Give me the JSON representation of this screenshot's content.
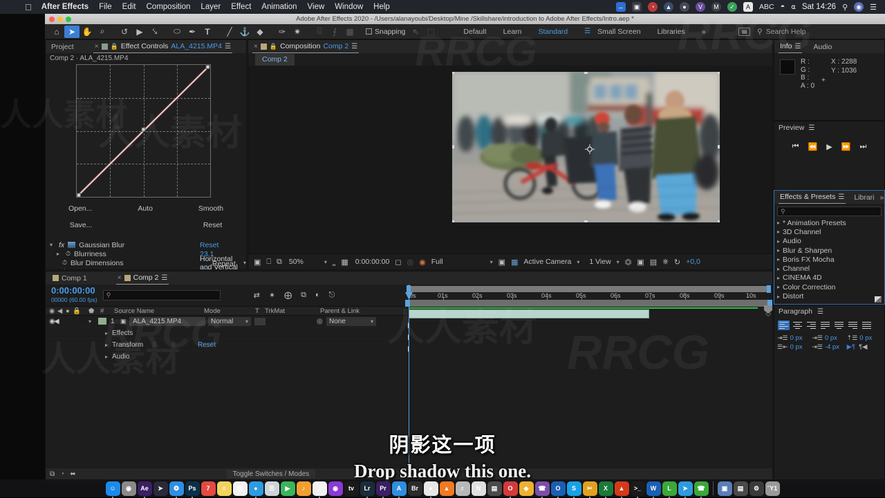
{
  "macos": {
    "apple_glyph": "&#63743;",
    "menus": [
      "After Effects",
      "File",
      "Edit",
      "Composition",
      "Layer",
      "Effect",
      "Animation",
      "View",
      "Window",
      "Help"
    ],
    "tray": [
      {
        "name": "displays-icon",
        "glyph": "↔",
        "color": "#2b6fd4"
      },
      {
        "name": "screen-record-icon",
        "glyph": "▣",
        "color": "#3a3f48"
      },
      {
        "name": "clock-alert-icon",
        "glyph": "◔",
        "color": "#b93a3a"
      },
      {
        "name": "bell-icon",
        "glyph": "▲",
        "color": "#3a4b6b"
      },
      {
        "name": "ninja-icon",
        "glyph": "●",
        "color": "#454a52"
      },
      {
        "name": "app-v-icon",
        "glyph": "V",
        "color": "#6a4b9c"
      },
      {
        "name": "app-m-icon",
        "glyph": "M",
        "color": "#3a3f48"
      },
      {
        "name": "checkmark-icon",
        "glyph": "✓",
        "color": "#3aa05a"
      },
      {
        "name": "letter-a-icon",
        "glyph": "A",
        "color": "#e8e8e8"
      }
    ],
    "abc_label": "ABC",
    "wifi_icon": "wifi-icon",
    "battery_icon": "battery-charging-icon",
    "clock": "Sat 14:26",
    "spotlight_icon": "search-icon",
    "siri_icon": "siri-icon",
    "control_center_icon": "control-center-icon"
  },
  "window": {
    "title": "Adobe After Effects 2020 - /Users/alanayoubi/Desktop/Mine /Skillshare/introduction to Adobe After Effects/Intro.aep *"
  },
  "toolbar": {
    "tools": [
      {
        "name": "home-icon",
        "glyph": "⌂",
        "selected": false
      },
      {
        "name": "selection-tool-icon",
        "glyph": "➤",
        "selected": true
      },
      {
        "name": "hand-tool-icon",
        "glyph": "✋",
        "selected": false
      },
      {
        "name": "zoom-tool-icon",
        "glyph": "⌕",
        "selected": false
      },
      {
        "name": "rotation-tool-icon",
        "glyph": "↺",
        "selected": false
      },
      {
        "name": "camera-tool-icon",
        "glyph": "▶",
        "selected": false
      },
      {
        "name": "anchor-point-tool-icon",
        "glyph": "✥",
        "selected": false
      },
      {
        "name": "shape-tool-icon",
        "glyph": "⬭",
        "selected": false
      },
      {
        "name": "pen-tool-icon",
        "glyph": "✒",
        "selected": false
      },
      {
        "name": "type-tool-icon",
        "glyph": "T",
        "selected": false
      },
      {
        "name": "brush-tool-icon",
        "glyph": "╱",
        "selected": false
      },
      {
        "name": "clone-stamp-tool-icon",
        "glyph": "⚓",
        "selected": false
      },
      {
        "name": "eraser-tool-icon",
        "glyph": "◆",
        "selected": false
      },
      {
        "name": "roto-brush-tool-icon",
        "glyph": "✒",
        "selected": false
      },
      {
        "name": "puppet-pin-tool-icon",
        "glyph": "✷",
        "selected": false
      }
    ],
    "dim_tools": [
      {
        "name": "align-left-icon",
        "glyph": "⌸"
      },
      {
        "name": "align-center-icon",
        "glyph": "⨍"
      },
      {
        "name": "distribute-icon",
        "glyph": "▦"
      }
    ],
    "snapping_label": "Snapping",
    "snap_extra": [
      {
        "name": "snap-arrow-icon",
        "glyph": "↖"
      },
      {
        "name": "snap-target-icon",
        "glyph": "⬚"
      }
    ],
    "workspaces": [
      "Default",
      "Learn",
      "Standard",
      "Small Screen",
      "Libraries"
    ],
    "active_workspace": "Standard",
    "overflow_label": "»",
    "workspace_menu_icon": "hamburger-icon",
    "sync_settings_icon": "sync-settings-icon",
    "search_help_placeholder": "Search Help",
    "search_help_icon": "search-icon"
  },
  "effect_controls": {
    "tabs": [
      {
        "name": "project-tab",
        "label": "Project",
        "active": false,
        "closeable": false
      },
      {
        "name": "effect-controls-tab",
        "label": "Effect Controls",
        "value": "ALA_4215.MP4",
        "active": true,
        "closeable": true
      }
    ],
    "panel_menu_icon": "hamburger-icon",
    "subtitle": "Comp 2 · ALA_4215.MP4",
    "curves": {
      "name": "curves-graph",
      "grid_lines": 4,
      "channels": [
        "composite",
        "red",
        "green"
      ]
    },
    "buttons_row1": [
      {
        "name": "open-button",
        "label": "Open..."
      },
      {
        "name": "auto-button",
        "label": "Auto"
      },
      {
        "name": "smooth-button",
        "label": "Smooth"
      }
    ],
    "buttons_row2": [
      {
        "name": "save-button",
        "label": "Save..."
      },
      {
        "name": "curves-reset-button",
        "label": "Reset"
      }
    ],
    "gaussian_blur": {
      "fx_label": "fx",
      "title": "Gaussian Blur",
      "reset_label": "Reset",
      "properties": [
        {
          "name": "blurriness-property",
          "label": "Blurriness",
          "value": "23,1",
          "type": "number",
          "expandable": true
        },
        {
          "name": "blur-dimensions-property",
          "label": "Blur Dimensions",
          "value": "Horizontal and Vertical",
          "type": "dropdown",
          "expandable": false
        },
        {
          "name": "repeat-edge-pixels-property",
          "label": "Repeat Edge Pixels",
          "value": "",
          "type": "checkbox",
          "checked": true
        }
      ]
    }
  },
  "composition": {
    "tab": {
      "label": "Composition",
      "value": "Comp 2",
      "closeable": true
    },
    "panel_menu_icon": "hamburger-icon",
    "comp_tab": "Comp 2",
    "viewer_bar": {
      "magnification": "50%",
      "time": "0:00:00:00",
      "resolution": "Full",
      "camera": "Active Camera",
      "views": "1 View",
      "offset": "+0,0",
      "icons": [
        {
          "name": "always-preview-icon",
          "glyph": "▣"
        },
        {
          "name": "toggle-transparency-icon",
          "glyph": "⌸"
        },
        {
          "name": "toggle-mask-icon",
          "glyph": "⧉"
        },
        {
          "name": "snapshot-icon",
          "glyph": "὏7"
        },
        {
          "name": "show-snapshot-icon",
          "glyph": "◎"
        },
        {
          "name": "channel-icon",
          "glyph": "◕"
        },
        {
          "name": "region-of-interest-icon",
          "glyph": "▢"
        },
        {
          "name": "transparency-grid-icon",
          "glyph": "▒"
        },
        {
          "name": "pixel-aspect-icon",
          "glyph": "⊞"
        },
        {
          "name": "fast-previews-icon",
          "glyph": "⚡"
        },
        {
          "name": "timeline-icon",
          "glyph": "☷"
        },
        {
          "name": "comp-flowchart-icon",
          "glyph": "⑂"
        },
        {
          "name": "reset-exposure-icon",
          "glyph": "↻"
        }
      ]
    }
  },
  "info_panel": {
    "tabs": [
      "Info",
      "Audio"
    ],
    "panel_menu_icon": "hamburger-icon",
    "channels": [
      {
        "label": "R :",
        "value": ""
      },
      {
        "label": "G :",
        "value": ""
      },
      {
        "label": "B :",
        "value": ""
      },
      {
        "label": "A :",
        "value": "0"
      }
    ],
    "coords": [
      {
        "label": "X :",
        "value": "2288"
      },
      {
        "label": "Y :",
        "value": "1036"
      }
    ]
  },
  "preview_panel": {
    "title": "Preview",
    "panel_menu_icon": "hamburger-icon",
    "controls": [
      {
        "name": "first-frame-button",
        "glyph": "⧏|"
      },
      {
        "name": "previous-frame-button",
        "glyph": "◀|"
      },
      {
        "name": "play-button",
        "glyph": "▶"
      },
      {
        "name": "next-frame-button",
        "glyph": "|▶"
      },
      {
        "name": "last-frame-button",
        "glyph": "|▷"
      }
    ]
  },
  "effects_presets": {
    "tabs": [
      "Effects & Presets",
      "Librari"
    ],
    "panel_menu_icon": "hamburger-icon",
    "overflow": "»",
    "search_placeholder": "",
    "search_icon": "search-icon",
    "items": [
      "* Animation Presets",
      "3D Channel",
      "Audio",
      "Blur & Sharpen",
      "Boris FX Mocha",
      "Channel",
      "CINEMA 4D",
      "Color Correction",
      "Distort"
    ]
  },
  "paragraph_panel": {
    "title": "Paragraph",
    "panel_menu_icon": "hamburger-icon",
    "align_buttons": [
      {
        "name": "align-left-button",
        "selected": true
      },
      {
        "name": "align-center-button",
        "selected": false
      },
      {
        "name": "align-right-button",
        "selected": false
      },
      {
        "name": "justify-last-left-button",
        "selected": false
      },
      {
        "name": "justify-last-center-button",
        "selected": false
      },
      {
        "name": "justify-last-right-button",
        "selected": false
      },
      {
        "name": "justify-all-button",
        "selected": false
      }
    ],
    "indents": [
      {
        "name": "indent-left-margin",
        "icon": "indent-left-icon",
        "value": "0 px"
      },
      {
        "name": "indent-first-line",
        "icon": "first-line-indent-icon",
        "value": "0 px"
      },
      {
        "name": "space-before-paragraph",
        "icon": "space-before-icon",
        "value": "0 px"
      },
      {
        "name": "indent-right-margin",
        "icon": "indent-right-icon",
        "value": "0 px"
      },
      {
        "name": "space-after-paragraph",
        "icon": "space-after-icon",
        "value": "-4 px"
      }
    ],
    "direction_buttons": [
      {
        "name": "ltr-direction-button",
        "glyph": "▶¶",
        "selected": true
      },
      {
        "name": "rtl-direction-button",
        "glyph": "¶◀",
        "selected": false
      }
    ]
  },
  "timeline": {
    "tabs": [
      {
        "name": "comp-1-tab",
        "label": "Comp 1",
        "active": false,
        "closeable": false
      },
      {
        "name": "comp-2-tab",
        "label": "Comp 2",
        "active": true,
        "closeable": true
      }
    ],
    "panel_menu_icon": "hamburger-icon",
    "current_time": "0:00:00:00",
    "frame_info": "00000 (60.00 fps)",
    "search_placeholder": "",
    "search_icon": "search-icon",
    "head_icons": [
      {
        "name": "composition-mini-flowchart-icon",
        "glyph": "⑂"
      },
      {
        "name": "draft-3d-icon",
        "glyph": "✦"
      },
      {
        "name": "hide-shy-layers-icon",
        "glyph": "⨁"
      },
      {
        "name": "frame-blending-icon",
        "glyph": "⧉"
      },
      {
        "name": "motion-blur-icon",
        "glyph": "◐"
      },
      {
        "name": "graph-editor-icon",
        "glyph": "⌧"
      }
    ],
    "columns": [
      "#",
      "Source Name",
      "Mode",
      "T",
      "TrkMat",
      "Parent & Link"
    ],
    "col_icons": [
      {
        "name": "video-visibility-icon",
        "glyph": "◉"
      },
      {
        "name": "audio-icon",
        "glyph": "◄"
      },
      {
        "name": "solo-icon",
        "glyph": "●"
      },
      {
        "name": "lock-icon",
        "glyph": "ὑ2"
      },
      {
        "name": "label-icon",
        "glyph": "⬟"
      }
    ],
    "layers": [
      {
        "index": "1",
        "source_name": "ALA_4215.MP4",
        "mode": "Normal",
        "trkmat": "",
        "parent": "None",
        "children": [
          {
            "name": "effects-group",
            "label": "Effects",
            "value": ""
          },
          {
            "name": "transform-group",
            "label": "Transform",
            "value": "Reset"
          },
          {
            "name": "audio-group",
            "label": "Audio",
            "value": ""
          }
        ]
      }
    ],
    "ruler_labels": [
      "0s",
      "01s",
      "02s",
      "03s",
      "04s",
      "05s",
      "06s",
      "07s",
      "08s",
      "09s",
      "10s"
    ],
    "status_icons": [
      {
        "name": "toggle-switches-modes-icon",
        "glyph": "⧉"
      },
      {
        "name": "frame-render-time-icon",
        "glyph": "◔"
      },
      {
        "name": "stretch-icon",
        "glyph": "⬌"
      }
    ],
    "status_label": "Toggle Switches / Modes"
  },
  "subtitles": {
    "chinese": "阴影这一项",
    "english": "Drop shadow this one."
  },
  "watermarks": {
    "brand": "RRCG",
    "chinese": "人人素材"
  },
  "dock": {
    "items": [
      {
        "name": "finder-icon",
        "glyph": "☺",
        "color": "#1c8ae8",
        "running": true
      },
      {
        "name": "launchpad-icon",
        "glyph": "◉",
        "color": "#8a8a8a",
        "running": false
      },
      {
        "name": "after-effects-icon",
        "glyph": "Ae",
        "color": "#3b1f63",
        "running": true
      },
      {
        "name": "rocket-icon",
        "glyph": "➤",
        "color": "#2a2a3a",
        "running": false
      },
      {
        "name": "safari-icon",
        "glyph": "❂",
        "color": "#2e8fe0",
        "running": true
      },
      {
        "name": "photoshop-icon",
        "glyph": "Ps",
        "color": "#0b2f4a",
        "running": true
      },
      {
        "name": "calendar-icon",
        "glyph": "7",
        "color": "#e24b42",
        "running": false
      },
      {
        "name": "notes-icon",
        "glyph": "≡",
        "color": "#f2d35c",
        "running": false
      },
      {
        "name": "reminders-icon",
        "glyph": "☰",
        "color": "#f0f0f0",
        "running": false
      },
      {
        "name": "messages-icon",
        "glyph": "●",
        "color": "#2e9be0",
        "running": true
      },
      {
        "name": "contacts-icon",
        "glyph": "☰",
        "color": "#cfd4d8",
        "running": false
      },
      {
        "name": "facetime-icon",
        "glyph": "▶",
        "color": "#3ab55a",
        "running": false
      },
      {
        "name": "itunes-store-icon",
        "glyph": "♪",
        "color": "#f0a030",
        "running": false
      },
      {
        "name": "music-icon",
        "glyph": "♫",
        "color": "#f2f2f2",
        "running": true
      },
      {
        "name": "podcasts-icon",
        "glyph": "◉",
        "color": "#8a3ad4",
        "running": false
      },
      {
        "name": "apple-tv-icon",
        "glyph": "tv",
        "color": "#1a1a1a",
        "running": false
      },
      {
        "name": "lightroom-icon",
        "glyph": "Lr",
        "color": "#1a2c3a",
        "running": true
      },
      {
        "name": "premiere-icon",
        "glyph": "Pr",
        "color": "#3b1f63",
        "running": true
      },
      {
        "name": "app-store-icon",
        "glyph": "A",
        "color": "#2e8fe0",
        "running": true
      },
      {
        "name": "adobe-bridge-icon",
        "glyph": "Br",
        "color": "#2b2b2b",
        "running": false
      },
      {
        "name": "chrome-icon",
        "glyph": "●",
        "color": "#e8e8e8",
        "running": true
      },
      {
        "name": "vlc-icon",
        "glyph": "▲",
        "color": "#f07a20",
        "running": false
      },
      {
        "name": "garageband-icon",
        "glyph": "♬",
        "color": "#b8b8b8",
        "running": false
      },
      {
        "name": "news-icon",
        "glyph": "N",
        "color": "#e0e0e0",
        "running": false
      },
      {
        "name": "books-icon",
        "glyph": "▤",
        "color": "#4a4a4a",
        "running": false
      },
      {
        "name": "opera-icon",
        "glyph": "O",
        "color": "#d43a3a",
        "running": true
      },
      {
        "name": "sketch-icon",
        "glyph": "◆",
        "color": "#f0b030",
        "running": false
      },
      {
        "name": "viber-icon",
        "glyph": "☎",
        "color": "#7b4fa8",
        "running": true
      },
      {
        "name": "outlook-icon",
        "glyph": "O",
        "color": "#1a5fb4",
        "running": true
      },
      {
        "name": "skype-icon",
        "glyph": "S",
        "color": "#18a0e8",
        "running": true
      },
      {
        "name": "cutter-icon",
        "glyph": "✂",
        "color": "#e0a020",
        "running": true
      },
      {
        "name": "excel-icon",
        "glyph": "X",
        "color": "#1a7a3a",
        "running": true
      },
      {
        "name": "fire-icon",
        "glyph": "▲",
        "color": "#d43a1a",
        "running": true
      },
      {
        "name": "terminal-icon",
        "glyph": ">_",
        "color": "#1a1a1a",
        "running": true
      },
      {
        "name": "word-icon",
        "glyph": "W",
        "color": "#1a5fb4",
        "running": true
      },
      {
        "name": "line-icon",
        "glyph": "L",
        "color": "#3aa83a",
        "running": true
      },
      {
        "name": "telegram-icon",
        "glyph": "➤",
        "color": "#2e9be0",
        "running": true
      },
      {
        "name": "whatsapp-icon",
        "glyph": "☎",
        "color": "#3aa83a",
        "running": true
      }
    ],
    "right_items": [
      {
        "name": "downloads-folder-icon",
        "glyph": "▣",
        "color": "#5a7fb8"
      },
      {
        "name": "documents-folder-icon",
        "glyph": "▤",
        "color": "#4a4a4a"
      },
      {
        "name": "tools-folder-icon",
        "glyph": "⚙",
        "color": "#3a3a3a"
      },
      {
        "name": "trash-icon",
        "glyph": "Ὕ1",
        "color": "#9a9a9a"
      }
    ]
  }
}
